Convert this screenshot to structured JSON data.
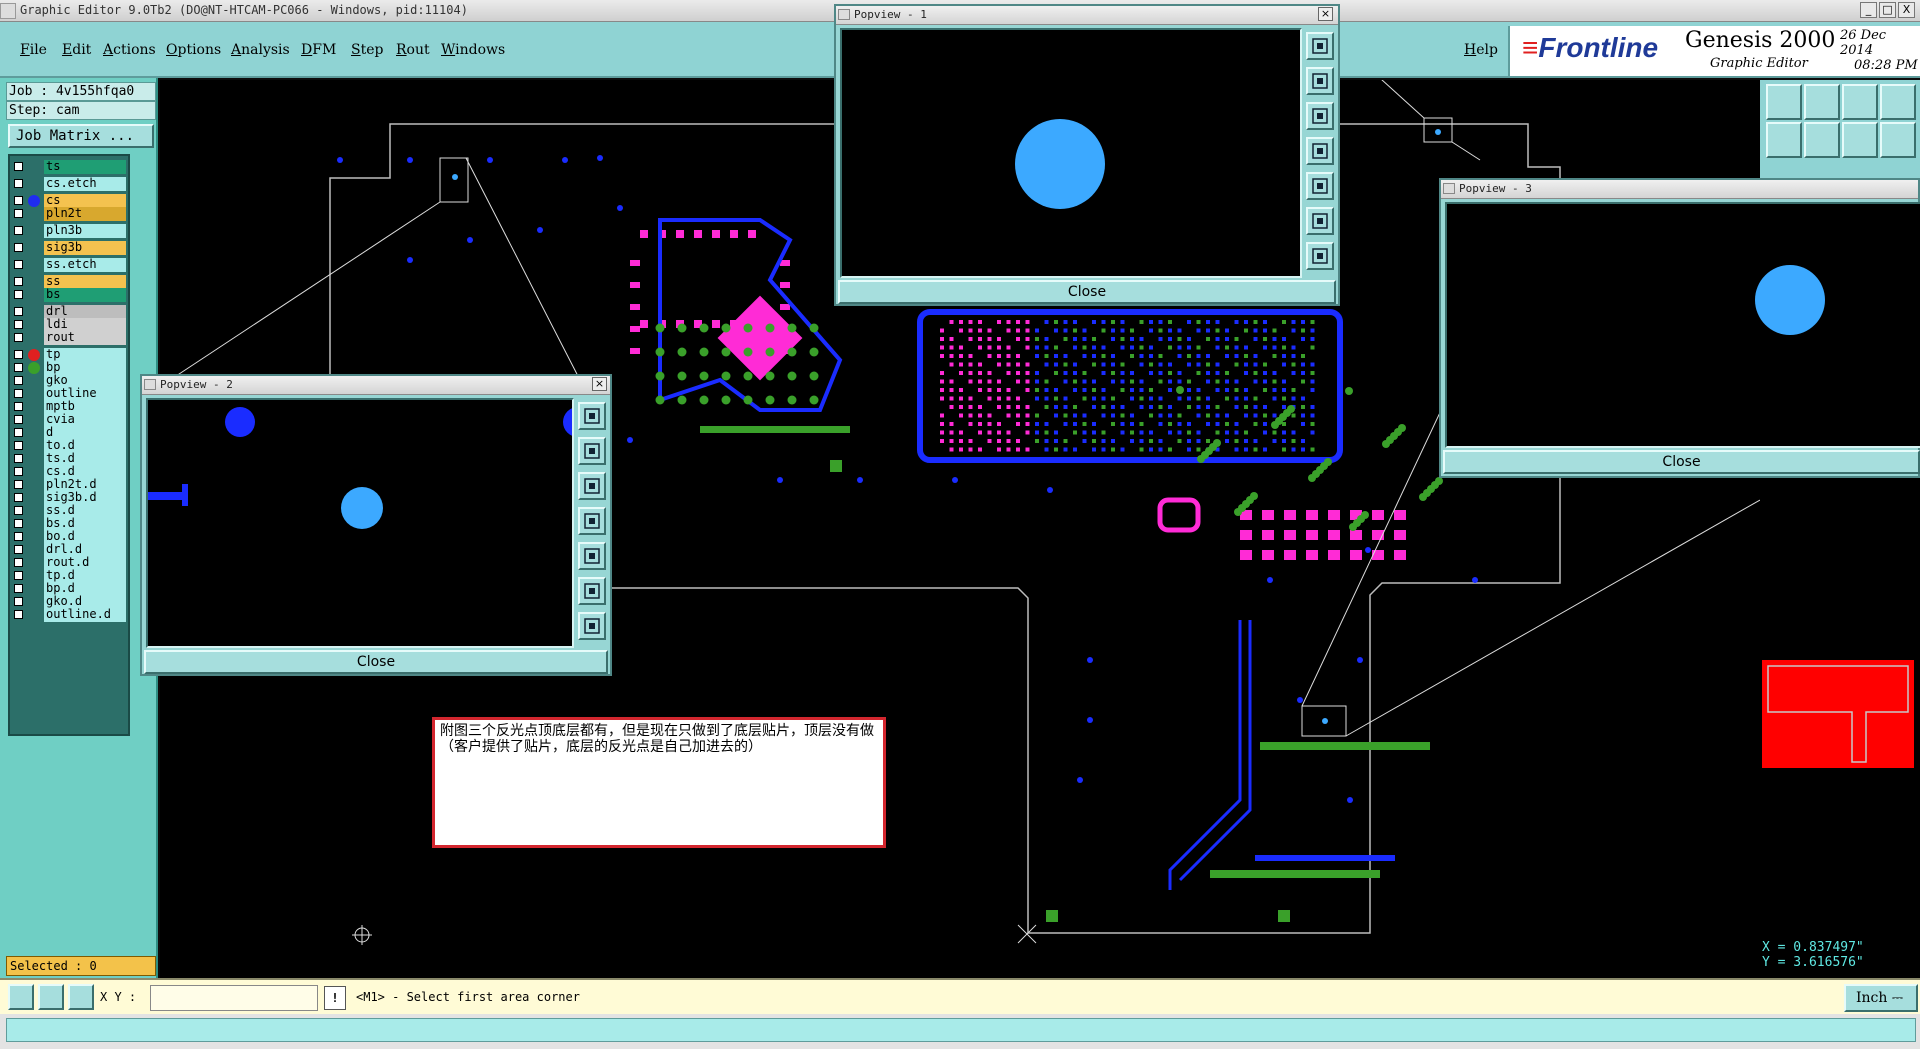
{
  "window": {
    "title": "Graphic Editor 9.0Tb2 (DO@NT-HTCAM-PC066 - Windows, pid:11104)",
    "controls": [
      "_",
      "□",
      "X"
    ]
  },
  "menu": {
    "items": [
      "File",
      "Edit",
      "Actions",
      "Options",
      "Analysis",
      "DFM",
      "Step",
      "Rout",
      "Windows"
    ],
    "help": "Help"
  },
  "brand": {
    "logo": "Frontline",
    "product": "Genesis 2000",
    "subtitle": "Graphic Editor",
    "date": "26 Dec 2014",
    "time": "08:28 PM"
  },
  "job": {
    "job_label": "Job : 4v155hfqa0",
    "step_label": "Step: cam",
    "matrix_button": "Job Matrix ..."
  },
  "layers": [
    {
      "name": "ts",
      "color": "#1f9e74",
      "dot": ""
    },
    {
      "name": "cs.etch",
      "color": "#a8ebe9",
      "dot": ""
    },
    {
      "name": "cs",
      "color": "#f4c24f",
      "dot": "#1f2cf0"
    },
    {
      "name": "pln2t",
      "color": "#d8a82e",
      "dot": ""
    },
    {
      "name": "pln3b",
      "color": "#a8ebe9",
      "dot": ""
    },
    {
      "name": "sig3b",
      "color": "#f4c24f",
      "dot": ""
    },
    {
      "name": "ss.etch",
      "color": "#a8ebe9",
      "dot": ""
    },
    {
      "name": "ss",
      "color": "#f4c24f",
      "dot": ""
    },
    {
      "name": "bs",
      "color": "#1f9e74",
      "dot": ""
    },
    {
      "name": "drl",
      "color": "#bdbdbd",
      "dot": ""
    },
    {
      "name": "ldi",
      "color": "#d0d0d0",
      "dot": ""
    },
    {
      "name": "rout",
      "color": "#d0d0d0",
      "dot": ""
    },
    {
      "name": "tp",
      "color": "#a8ebe9",
      "dot": "#e02020"
    },
    {
      "name": "bp",
      "color": "#a8ebe9",
      "dot": "#3aa02a"
    },
    {
      "name": "gko",
      "color": "#a8ebe9",
      "dot": ""
    },
    {
      "name": "outline",
      "color": "#a8ebe9",
      "dot": ""
    },
    {
      "name": "mptb",
      "color": "#a8ebe9",
      "dot": ""
    },
    {
      "name": "cvia",
      "color": "#a8ebe9",
      "dot": ""
    },
    {
      "name": "d",
      "color": "#a8ebe9",
      "dot": ""
    },
    {
      "name": "to.d",
      "color": "#a8ebe9",
      "dot": ""
    },
    {
      "name": "ts.d",
      "color": "#a8ebe9",
      "dot": ""
    },
    {
      "name": "cs.d",
      "color": "#a8ebe9",
      "dot": ""
    },
    {
      "name": "pln2t.d",
      "color": "#a8ebe9",
      "dot": ""
    },
    {
      "name": "sig3b.d",
      "color": "#a8ebe9",
      "dot": ""
    },
    {
      "name": "ss.d",
      "color": "#a8ebe9",
      "dot": ""
    },
    {
      "name": "bs.d",
      "color": "#a8ebe9",
      "dot": ""
    },
    {
      "name": "bo.d",
      "color": "#a8ebe9",
      "dot": ""
    },
    {
      "name": "drl.d",
      "color": "#a8ebe9",
      "dot": ""
    },
    {
      "name": "rout.d",
      "color": "#a8ebe9",
      "dot": ""
    },
    {
      "name": "tp.d",
      "color": "#a8ebe9",
      "dot": ""
    },
    {
      "name": "bp.d",
      "color": "#a8ebe9",
      "dot": ""
    },
    {
      "name": "gko.d",
      "color": "#a8ebe9",
      "dot": ""
    },
    {
      "name": "outline.d",
      "color": "#a8ebe9",
      "dot": ""
    }
  ],
  "status": {
    "selected": "Selected : 0",
    "xy_label": "X Y :",
    "xy_value": "",
    "exclaim": "!",
    "prompt": "<M1> - Select first area corner",
    "unit": "Inch",
    "x_coord": "X = 0.837497\"",
    "y_coord": "Y = 3.616576\""
  },
  "popups": [
    {
      "title": "Popview - 1",
      "close": "Close"
    },
    {
      "title": "Popview - 2",
      "close": "Close"
    },
    {
      "title": "Popview - 3",
      "close": "Close"
    }
  ],
  "note": {
    "text": "附图三个反光点顶底层都有，但是现在只做到了底层贴片，顶层没有做（客户提供了贴片，底层的反光点是自己加进去的）"
  },
  "colors": {
    "background": "#000000",
    "trace_blue": "#1a2cff",
    "pad_magenta": "#ff2bd6",
    "via_green": "#3aa02a",
    "fiducial_blue": "#3ca9ff",
    "panel_teal": "#8fd3d3",
    "profile_red": "#ff0000"
  }
}
